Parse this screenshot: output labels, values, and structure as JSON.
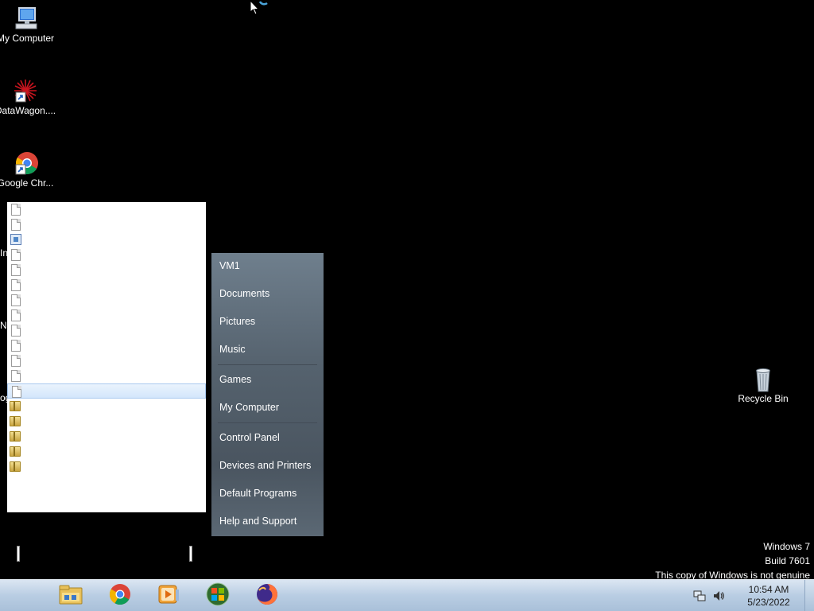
{
  "desktop_icons": [
    {
      "label": "My Computer",
      "icon": "computer-icon"
    },
    {
      "label": "DataWagon....",
      "icon": "datawagon-icon"
    },
    {
      "label": "Google Chr...",
      "icon": "chrome-icon"
    }
  ],
  "partial_labels": {
    "a": "In",
    "b": "Ne",
    "c": "og"
  },
  "start_menu": {
    "programs": [
      {
        "icon": "document-icon"
      },
      {
        "icon": "document-icon"
      },
      {
        "icon": "image-icon"
      },
      {
        "icon": "document-icon"
      },
      {
        "icon": "document-icon"
      },
      {
        "icon": "document-icon"
      },
      {
        "icon": "document-icon"
      },
      {
        "icon": "document-icon"
      },
      {
        "icon": "document-icon"
      },
      {
        "icon": "document-icon"
      },
      {
        "icon": "document-icon"
      },
      {
        "icon": "document-icon"
      },
      {
        "icon": "document-icon",
        "selected": true
      },
      {
        "icon": "folder-icon"
      },
      {
        "icon": "folder-icon"
      },
      {
        "icon": "folder-icon"
      },
      {
        "icon": "folder-icon"
      },
      {
        "icon": "folder-icon"
      }
    ],
    "right_items": {
      "user": "VM1",
      "documents": "Documents",
      "pictures": "Pictures",
      "music": "Music",
      "games": "Games",
      "computer": "My Computer",
      "control_panel": "Control Panel",
      "devices": "Devices and Printers",
      "defaults": "Default Programs",
      "help": "Help and Support"
    }
  },
  "recycle_bin": {
    "label": "Recycle Bin"
  },
  "watermark": {
    "line1": "Windows 7",
    "line2": "Build 7601",
    "line3": "This copy of Windows is not genuine"
  },
  "taskbar": {
    "pinned": [
      "explorer-icon",
      "chrome-icon",
      "media-player-icon",
      "windows-update-icon",
      "firefox-icon"
    ],
    "clock": {
      "time": "10:54 AM",
      "date": "5/23/2022"
    }
  },
  "colors": {
    "taskbar": "#b9cde3",
    "start_right": "#55626e",
    "selection": "#d3e6fb"
  }
}
